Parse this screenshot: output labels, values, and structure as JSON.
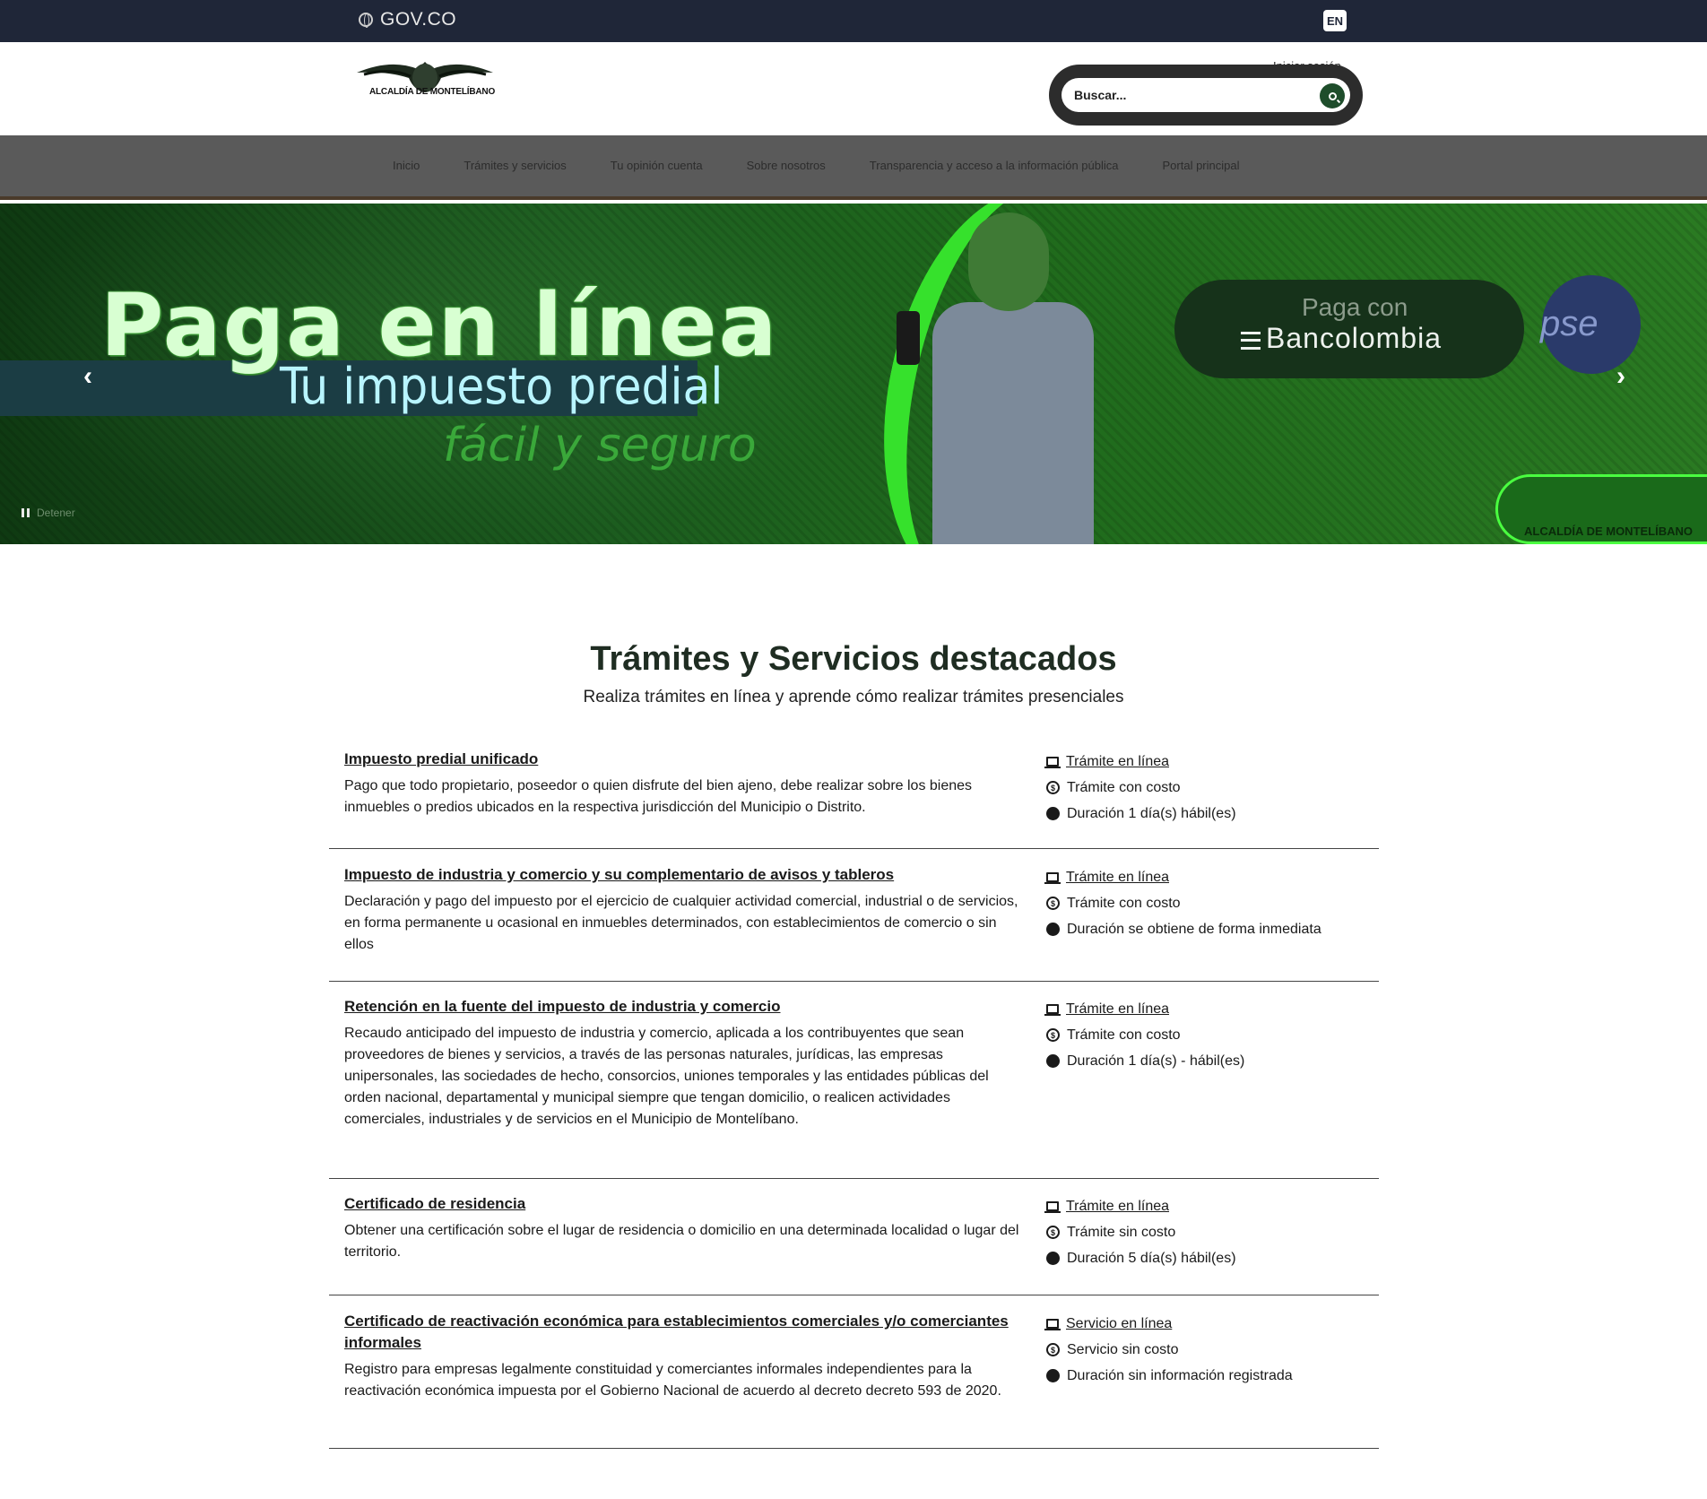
{
  "govbar": {
    "brand": "GOV.CO",
    "lang": "EN"
  },
  "header": {
    "logo_text": "ALCALDÍA DE MONTELÍBANO",
    "login": "Iniciar sesión",
    "search_placeholder": "Buscar..."
  },
  "nav": [
    "Inicio",
    "Trámites y servicios",
    "Tu opinión cuenta",
    "Sobre nosotros",
    "Transparencia y acceso a la información pública",
    "Portal principal"
  ],
  "banner": {
    "title": "Paga en línea",
    "subtitle": "Tu impuesto predial",
    "slogan": "fácil y seguro",
    "bank_small": "Paga con",
    "bank_name": "Bancolombia",
    "pse": "pse",
    "seal_text": "ALCALDÍA DE MONTELÍBANO",
    "pause_label": "Detener"
  },
  "section": {
    "title": "Trámites y Servicios destacados",
    "subtitle": "Realiza trámites en línea y aprende cómo realizar trámites presenciales"
  },
  "items": [
    {
      "title": "Impuesto predial unificado",
      "desc": "Pago que todo propietario, poseedor o quien disfrute del bien ajeno, debe realizar sobre los bienes inmuebles o predios ubicados en la respectiva jurisdicción del Municipio o Distrito.",
      "mode": "Trámite en línea",
      "cost": "Trámite con costo",
      "duration": "Duración 1 día(s) hábil(es)"
    },
    {
      "title": "Impuesto de industria y comercio y su complementario de avisos y tableros",
      "desc": "Declaración y pago del impuesto por el ejercicio de cualquier actividad comercial, industrial o de servicios, en forma permanente u ocasional en inmuebles determinados, con establecimientos de comercio o sin ellos",
      "mode": "Trámite en línea",
      "cost": "Trámite con costo",
      "duration": "Duración se obtiene de forma inmediata"
    },
    {
      "title": "Retención en la fuente del impuesto de industria y comercio",
      "desc": "Recaudo anticipado del impuesto de industria y comercio, aplicada a los contribuyentes que sean proveedores de bienes y servicios, a través de las personas naturales, jurídicas, las empresas unipersonales, las sociedades de hecho, consorcios, uniones temporales y las entidades públicas del orden nacional, departamental y municipal siempre que tengan domicilio, o realicen actividades comerciales, industriales y de servicios en el Municipio de Montelíbano.",
      "mode": "Trámite en línea",
      "cost": "Trámite con costo",
      "duration": "Duración 1 día(s) - hábil(es)"
    },
    {
      "title": "Certificado de residencia",
      "desc": "Obtener una certificación sobre el lugar de residencia o domicilio en una determinada localidad o lugar del territorio.",
      "mode": "Trámite en línea",
      "cost": "Trámite sin costo",
      "duration": "Duración 5 día(s) hábil(es)"
    },
    {
      "title": "Certificado de reactivación económica para establecimientos comerciales y/o comerciantes informales",
      "desc": "Registro para empresas legalmente constituidad y comerciantes informales independientes para la reactivación económica impuesta por el Gobierno Nacional de acuerdo al decreto decreto 593 de 2020.",
      "mode": "Servicio en línea",
      "cost": "Servicio sin costo",
      "duration": "Duración sin información registrada"
    }
  ]
}
